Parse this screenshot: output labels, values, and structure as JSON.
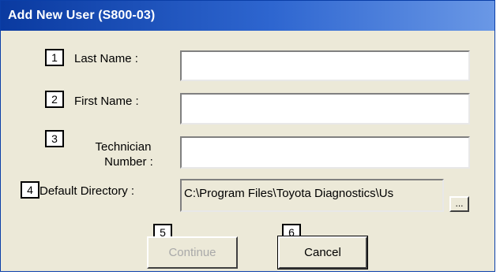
{
  "window": {
    "title": "Add New User (S800-03)"
  },
  "fields": [
    {
      "number": "1",
      "label": "Last Name :",
      "value": ""
    },
    {
      "number": "2",
      "label": "First Name :",
      "value": ""
    },
    {
      "number": "3",
      "label_line1": "Technician",
      "label_line2": "Number :",
      "value": ""
    }
  ],
  "directory": {
    "number": "4",
    "label": "Default Directory :",
    "value": "C:\\Program Files\\Toyota Diagnostics\\Us",
    "browse_label": "..."
  },
  "buttons": {
    "continue_number": "5",
    "continue_label": "Continue",
    "continue_disabled": true,
    "cancel_number": "6",
    "cancel_label": "Cancel"
  },
  "colors": {
    "titlebar_start": "#0a3aa0",
    "titlebar_end": "#6a98e6",
    "dialog_bg": "#ece9d8"
  }
}
